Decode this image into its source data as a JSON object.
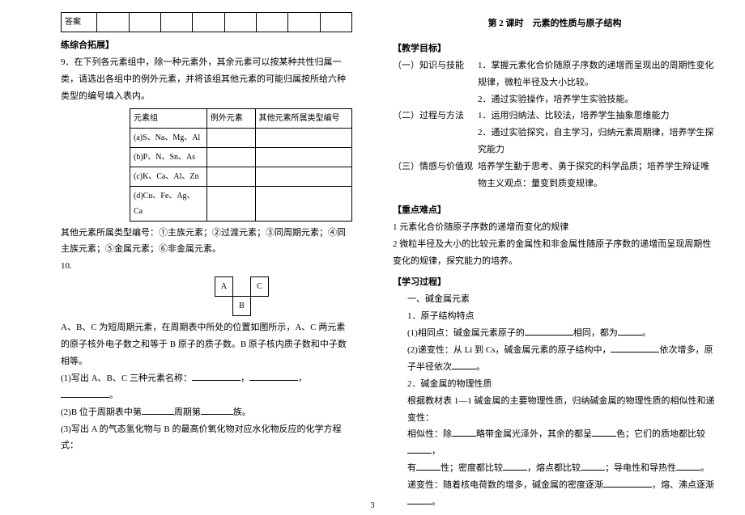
{
  "left": {
    "answer_label": "答案",
    "expand_header": "练综合拓展】",
    "q9_text": "9．在下列各元素组中，除一种元素外，其余元素可以按某种共性归属一类，请选出各组中的例外元素，并将该组其他元素的可能归属按所给六种类型的编号填入表内。",
    "elem_header": [
      "元素组",
      "例外元素",
      "其他元素所属类型编号"
    ],
    "elem_rows": [
      "(a)S、Na、Mg、Al",
      "(b)P、N、Sn、As",
      "(c)K、Ca、Al、Zn",
      "(d)Cu、Fe、Ag、Ca"
    ],
    "q9_note": "其他元素所属类型编号：①主族元素；②过渡元素；③同周期元素；④同主族元素；⑤金属元素；⑥非金属元素。",
    "q10_label": "10.",
    "small_cells": {
      "a": "A",
      "b": "B",
      "c": "C"
    },
    "q10_intro": "A、B、C 为短周期元素，在周期表中所处的位置如图所示，A、C 两元素的原子核外电子数之和等于 B 原子的质子数。B 原子核内质子数和中子数相等。",
    "q10_1a": "(1)写出 A、B、C 三种元素名称：",
    "q10_1b": "，",
    "q10_1c": "，",
    "q10_1d": "。",
    "q10_2a": "(2)B 位于周期表中第",
    "q10_2b": "周期第",
    "q10_2c": "族。",
    "q10_3": "(3)写出 A 的气态氢化物与 B 的最高价氧化物对应水化物反应的化学方程式："
  },
  "right": {
    "title": "第 2 课时　元素的性质与原子结构",
    "goal_hdr": "【教学目标】",
    "g1_lab": "（一）知识与技能",
    "g1_1": "1．掌握元素化合价随原子序数的递增而呈现出的周期性变化规律，微粒半径及大小比较。",
    "g1_2": "2．通过实验操作，培养学生实验技能。",
    "g2_lab": "（二）过程与方法",
    "g2_1": "1．运用归纳法、比较法，培养学生抽象思维能力",
    "g2_2": "2．通过实验探究，自主学习，归纳元素周期律，培养学生探究能力",
    "g3_lab": "（三）情感与价值观",
    "g3_1": "培养学生勤于思考、勇于探究的科学品质；培养学生辩证唯物主义观点：量变到质变规律。",
    "keypoint_hdr": "【重点难点】",
    "kp1": "1 元素化合价随原子序数的递增而变化的规律",
    "kp2": "2 微粒半径及大小的比较元素的金属性和非金属性随原子序数的递增而呈现周期性变化的规律，探究能力的培养。",
    "process_hdr": "【学习过程】",
    "p1": "一、碱金属元素",
    "p2": "1．原子结构特点",
    "p3a": "(1)相同点：碱金属元素原子的",
    "p3b": "相同，都为",
    "p3c": "。",
    "p4a": "(2)递变性：从 Li 到 Cs，碱金属元素的原子结构中，",
    "p4b": "依次增多，原子半径依次",
    "p4c": "。",
    "p5": "2．碱金属的物理性质",
    "p6": "根据教材表 1—1 碱金属的主要物理性质，归纳碱金属的物理性质的相似性和递变性：",
    "p7a": "相似性：除",
    "p7b": "略带金属光泽外，其余的都呈",
    "p7c": "色；它们的质地都比较",
    "p7d": "，",
    "p8a": "有",
    "p8b": "性；密度都比较",
    "p8c": "，熔点都比较",
    "p8d": "；导电性和导热性",
    "p8e": "。",
    "p9a": "递变性：随着核电荷数的增多，碱金属的密度逐渐",
    "p9b": "，熔、沸点逐渐",
    "p9c": "。"
  },
  "page": "3"
}
